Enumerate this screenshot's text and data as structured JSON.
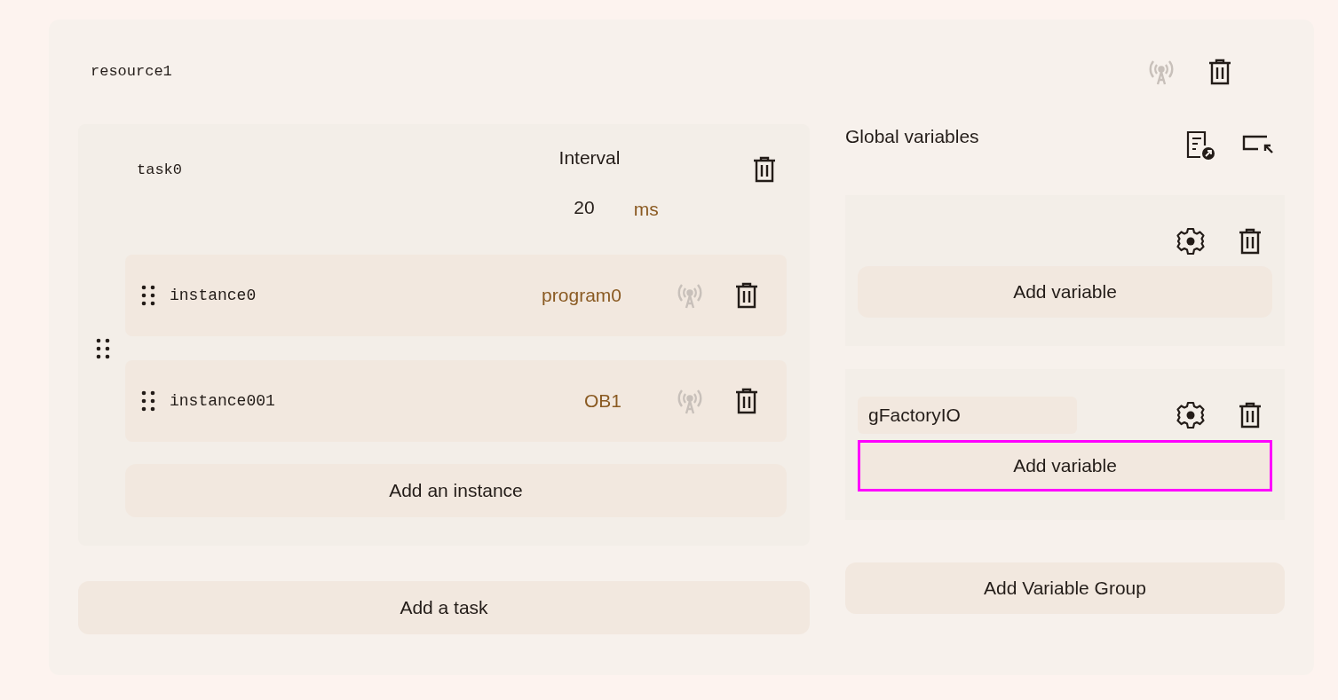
{
  "resource": {
    "name": "resource1"
  },
  "tasks": [
    {
      "name": "task0",
      "interval_label": "Interval",
      "interval": "20",
      "unit": "ms",
      "instances": [
        {
          "name": "instance0",
          "program": "program0"
        },
        {
          "name": "instance001",
          "program": "OB1"
        }
      ],
      "add_instance": "Add an instance"
    }
  ],
  "add_task": "Add a task",
  "global_variables": {
    "title": "Global variables",
    "groups": [
      {
        "add_variable": {
          "label": "Add variable",
          "focused": false
        }
      },
      {
        "name": "gFactoryIO",
        "add_variable": {
          "label": "Add variable",
          "focused": true
        }
      }
    ],
    "add_group": "Add Variable Group"
  }
}
